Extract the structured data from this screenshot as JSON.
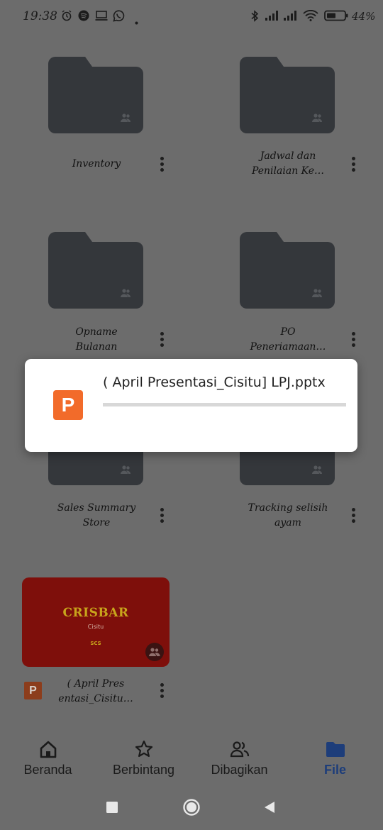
{
  "status_bar": {
    "time": "19:38",
    "battery": "44%",
    "icons": [
      "alarm-icon",
      "spotify-icon",
      "cast-icon",
      "whatsapp-icon",
      "dot-icon",
      "bluetooth-icon",
      "signal-icon",
      "signal-icon",
      "wifi-icon",
      "battery-icon"
    ]
  },
  "items": [
    {
      "name_line1": "Inventory",
      "name_line2": "",
      "type": "shared-folder"
    },
    {
      "name_line1": "Jadwal dan",
      "name_line2": "Penilaian Ke…",
      "type": "shared-folder"
    },
    {
      "name_line1": "Opname",
      "name_line2": "Bulanan",
      "type": "shared-folder"
    },
    {
      "name_line1": "PO",
      "name_line2": "Peneriamaan…",
      "type": "shared-folder"
    },
    {
      "name_line1": "Sales Summary",
      "name_line2": "Store",
      "type": "shared-folder"
    },
    {
      "name_line1": "Tracking selisih",
      "name_line2": "ayam",
      "type": "shared-folder"
    },
    {
      "name_line1": "( April Pres",
      "name_line2": "entasi_Cisitu…",
      "type": "pptx"
    }
  ],
  "thumbnail": {
    "brand": "CRISBAR",
    "subtitle": "Cisitu",
    "code": "SCS"
  },
  "ppt_badge_letter": "P",
  "dialog": {
    "filename": "( April Presentasi_Cisitu] LPJ.pptx",
    "progress": 0.0
  },
  "bottom_nav": [
    {
      "label": "Beranda",
      "icon": "home-icon",
      "active": false
    },
    {
      "label": "Berbintang",
      "icon": "star-icon",
      "active": false
    },
    {
      "label": "Dibagikan",
      "icon": "people-icon",
      "active": false
    },
    {
      "label": "File",
      "icon": "folder-icon",
      "active": true
    }
  ],
  "colors": {
    "scrim_background": "#6c6c6c",
    "folder": "#34373b",
    "ppt_orange": "#f26b2a",
    "active_nav": "#1d3d7a"
  }
}
